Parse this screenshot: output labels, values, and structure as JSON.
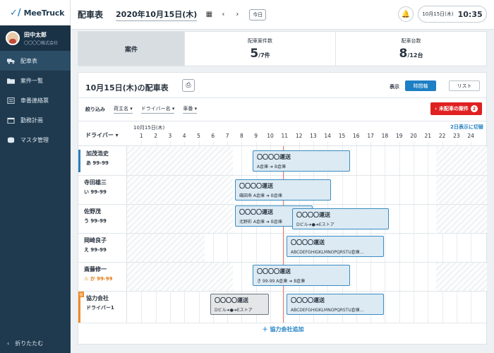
{
  "app": {
    "logo_mark": "✓/",
    "logo_text": "MeeTruck"
  },
  "user": {
    "name": "田中太郎",
    "company": "〇〇〇〇株式会社"
  },
  "sidebar": {
    "items": [
      {
        "label": "配車表",
        "icon": "truck-icon"
      },
      {
        "label": "案件一覧",
        "icon": "folder-icon"
      },
      {
        "label": "車番連絡票",
        "icon": "document-icon"
      },
      {
        "label": "勤務計画",
        "icon": "calendar-icon"
      },
      {
        "label": "マスタ管理",
        "icon": "database-icon"
      }
    ],
    "collapse_label": "折りたたむ"
  },
  "header": {
    "title": "配車表",
    "date": "2020年10月15日(木)",
    "today_label": "今日",
    "clock_date": "10月15日(木)",
    "clock_time": "10:35"
  },
  "summary": {
    "first_label": "案件",
    "cases_label": "配車案件数",
    "cases_value": "5",
    "cases_unit": "/7件",
    "vehicles_label": "配車台数",
    "vehicles_value": "8",
    "vehicles_unit": "/12台"
  },
  "panel": {
    "title": "10月15日(木)の配車表",
    "view_label": "表示",
    "view_timeline": "時間軸",
    "view_list": "リスト",
    "filter_label": "絞り込み",
    "filters": [
      "荷主名",
      "ドライバー名",
      "車番"
    ],
    "unassigned_label": "未配車の案件",
    "unassigned_count": "2",
    "driver_header": "ドライバー",
    "date_label": "10月15日(木)",
    "two_day": "2日表示に切替",
    "hours": [
      "1",
      "2",
      "3",
      "4",
      "5",
      "6",
      "7",
      "8",
      "9",
      "10",
      "11",
      "12",
      "13",
      "14",
      "15",
      "16",
      "17",
      "18",
      "19",
      "20",
      "21",
      "22",
      "23",
      "24"
    ],
    "add_partner": "協力会社追加"
  },
  "drivers": [
    {
      "name": "加茂浩史",
      "plate": "あ 99-99"
    },
    {
      "name": "寺田雄三",
      "plate": "い 99-99"
    },
    {
      "name": "佐野茂",
      "plate": "う 99-99"
    },
    {
      "name": "岡崎良子",
      "plate": "え 99-99"
    },
    {
      "name": "斎藤修一",
      "plate": "か 99-99"
    },
    {
      "name": "協力会社",
      "plate": "ドライバー1",
      "tag": "協"
    }
  ],
  "jobs": [
    {
      "title": "〇〇〇〇運送",
      "sub": "A倉庫 ➜ B倉庫"
    },
    {
      "title": "〇〇〇〇運送",
      "sub": "磯田寿 A倉庫 ➜ B倉庫"
    },
    {
      "title": "〇〇〇〇運送",
      "sub": "北野彩 A倉庫 ➜ B倉庫"
    },
    {
      "title": "〇〇〇〇運送",
      "sub": "Dビル➜●➜Eストア"
    },
    {
      "title": "〇〇〇〇運送",
      "sub": "ABCDEFGHIGKLMNOPQRSTU倉庫…"
    },
    {
      "title": "〇〇〇〇運送",
      "sub": "き 99-99 A倉庫 ➜ B倉庫"
    },
    {
      "title": "〇〇〇〇運送",
      "sub": "Dビル➜●➜Eストア"
    },
    {
      "title": "〇〇〇〇運送",
      "sub": "ABCDEFGHIGKLMNOPQRSTU倉庫…"
    }
  ],
  "colors": {
    "accent": "#1d7fc4",
    "sidebar": "#1f3a4f",
    "alert": "#e02020",
    "partner": "#f08a24",
    "now_line": "#e07060"
  }
}
